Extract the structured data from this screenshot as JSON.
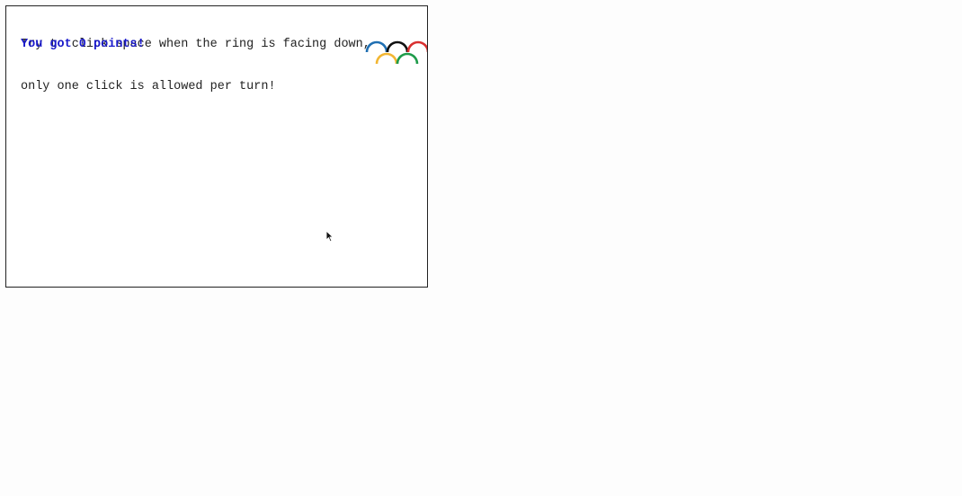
{
  "game": {
    "instructions": [
      "Try to click space when the ring is facing down,",
      "only one click is allowed per turn!"
    ],
    "score_text": "You got 0 points!",
    "score": 0
  },
  "rings": {
    "icon": "olympic-rings-icon",
    "colors": {
      "blue": "#1f6fb2",
      "black": "#111111",
      "red": "#d93030",
      "yellow": "#f2b632",
      "green": "#1e9b4a"
    }
  },
  "colors": {
    "score_text": "#1a1acc",
    "instruction_text": "#222222",
    "border": "#222222"
  }
}
